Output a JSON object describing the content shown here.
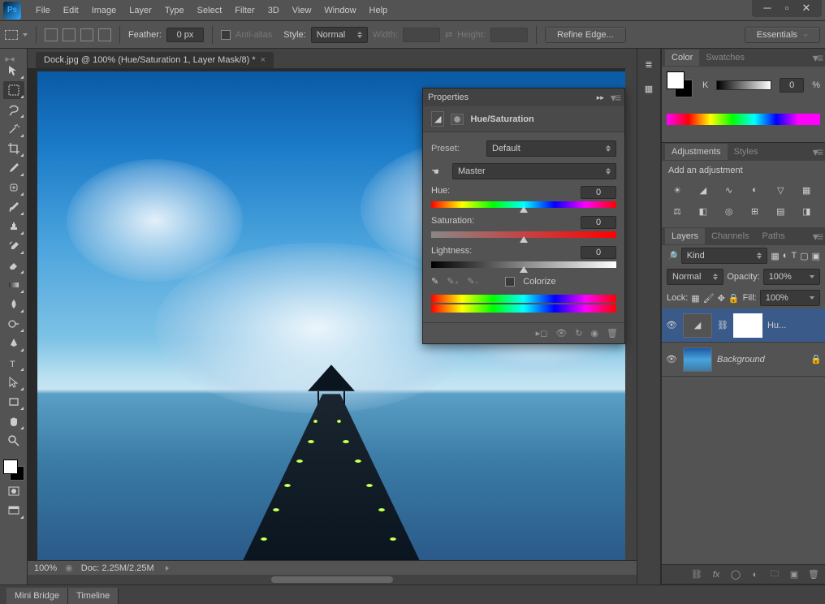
{
  "menu": [
    "File",
    "Edit",
    "Image",
    "Layer",
    "Type",
    "Select",
    "Filter",
    "3D",
    "View",
    "Window",
    "Help"
  ],
  "optbar": {
    "feather_label": "Feather:",
    "feather_value": "0 px",
    "antialias": "Anti-alias",
    "style_label": "Style:",
    "style_value": "Normal",
    "width_label": "Width:",
    "height_label": "Height:",
    "refine": "Refine Edge...",
    "essentials": "Essentials"
  },
  "doc_tab": "Dock.jpg @ 100% (Hue/Saturation 1, Layer Mask/8) *",
  "status": {
    "zoom": "100%",
    "doc": "Doc: 2.25M/2.25M"
  },
  "bottom_tabs": [
    "Mini Bridge",
    "Timeline"
  ],
  "color_panel": {
    "tabs": [
      "Color",
      "Swatches"
    ],
    "k_label": "K",
    "k_value": "0",
    "pct": "%"
  },
  "adjustments": {
    "tabs": [
      "Adjustments",
      "Styles"
    ],
    "hint": "Add an adjustment"
  },
  "layers": {
    "tabs": [
      "Layers",
      "Channels",
      "Paths"
    ],
    "kind": "Kind",
    "blend": "Normal",
    "opacity_label": "Opacity:",
    "opacity_value": "100%",
    "lock_label": "Lock:",
    "fill_label": "Fill:",
    "fill_value": "100%",
    "items": [
      {
        "name": "Hu...",
        "type": "adjustment"
      },
      {
        "name": "Background",
        "type": "image",
        "locked": true
      }
    ]
  },
  "props": {
    "title": "Properties",
    "adj_name": "Hue/Saturation",
    "preset_label": "Preset:",
    "preset_value": "Default",
    "channel_value": "Master",
    "hue_label": "Hue:",
    "hue_value": "0",
    "sat_label": "Saturation:",
    "sat_value": "0",
    "light_label": "Lightness:",
    "light_value": "0",
    "colorize": "Colorize"
  }
}
